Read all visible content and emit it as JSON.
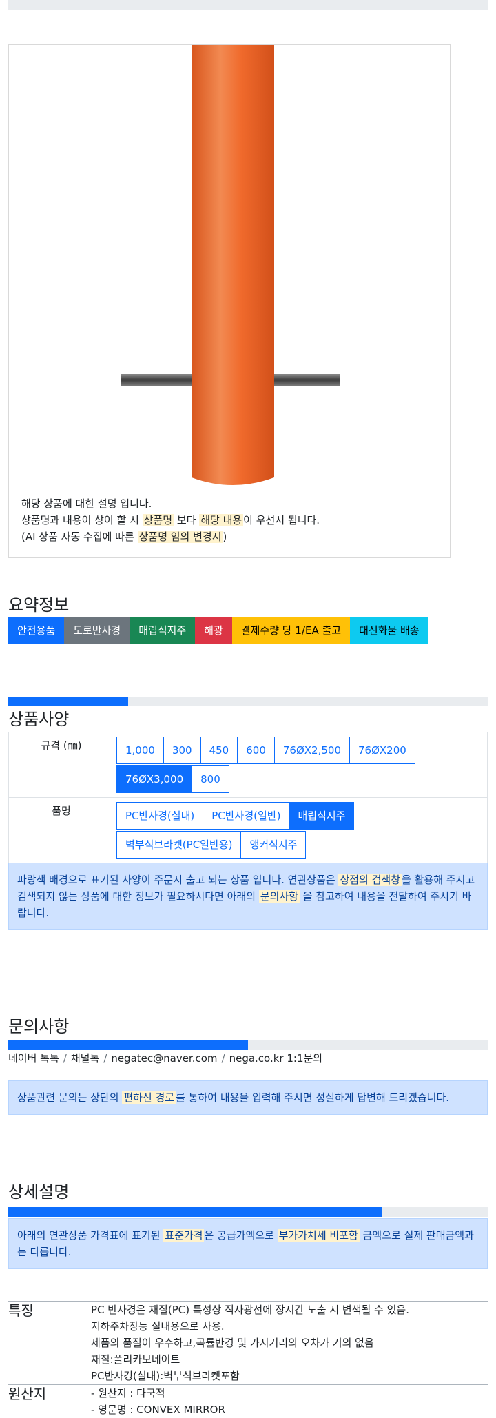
{
  "product_description": {
    "line1": "해당 상품에 대한 설명 입니다.",
    "line2_a": "상품명과 내용이 상이 할 시 ",
    "line2_hl1": "상품명",
    "line2_b": " 보다 ",
    "line2_hl2": "해당 내용",
    "line2_c": "이 우선시 됩니다.",
    "line3_a": "(AI 상품 자동 수집에 따른 ",
    "line3_hl": "상품명 임의 변경시",
    "line3_b": ")"
  },
  "summary": {
    "title": "요약정보",
    "badges": [
      {
        "label": "안전용품",
        "color": "#0d6efd"
      },
      {
        "label": "도로반사경",
        "color": "#6c757d"
      },
      {
        "label": "매립식지주",
        "color": "#198754"
      },
      {
        "label": "해광",
        "color": "#dc3545"
      },
      {
        "label": "결제수량 당 1/EA 출고",
        "color": "#ffc107"
      },
      {
        "label": "대신화물 배송",
        "color": "#0dcaf0"
      }
    ]
  },
  "spec": {
    "title": "상품사양",
    "progress": 0.25,
    "size_label": "규격 (㎜)",
    "size_options": [
      "1,000",
      "300",
      "450",
      "600",
      "76ØX2,500",
      "76ØX200",
      "76ØX3,000",
      "800"
    ],
    "size_selected": "76ØX3,000",
    "name_label": "품명",
    "name_options": [
      "PC반사경(실내)",
      "PC반사경(일반)",
      "매립식지주",
      "벽부식브라켓(PC일반용)",
      "앵커식지주"
    ],
    "name_selected": "매립식지주",
    "notice_a": "파랑색 배경으로 표기된 사양이 주문시 출고 되는 상품 입니다. 연관상품은 ",
    "notice_hl1": "상점의 검색창",
    "notice_b": "을 활용해 주시고 검색되지 않는 상품에 대한 정보가 필요하시다면 아래의 ",
    "notice_hl2": "문의사항",
    "notice_c": " 을 참고하여 내용을 전달하여 주시기 바랍니다."
  },
  "inquiry": {
    "title": "문의사항",
    "progress": 0.5,
    "contacts": [
      "네이버 톡톡",
      "채널톡",
      "negatec@naver.com",
      "nega.co.kr 1:1문의"
    ],
    "notice_a": "상품관련 문의는 상단의 ",
    "notice_hl": "편하신 경로",
    "notice_b": "를 통하여 내용을 입력해 주시면 성실하게 답변해 드리겠습니다."
  },
  "detail": {
    "title": "상세설명",
    "progress": 0.78,
    "notice_a": "아래의 연관상품 가격표에 표기된 ",
    "notice_hl1": "표준가격",
    "notice_b": "은 공급가액으로 ",
    "notice_hl2": "부가가치세 비포함",
    "notice_c": " 금액으로 실제 판매금액과는 다릅니다.",
    "features_label": "특징",
    "features": [
      "PC 반사경은 재질(PC) 특성상 직사광선에 장시간 노출 시 변색될 수 있음.",
      "지하주차장등 실내용으로 사용.",
      "제품의 품질이 우수하고,곡률반경 및 가시거리의 오차가 거의 없음",
      "재질:폴리카보네이트",
      "PC반사경(실내):벽부식브라켓포함"
    ],
    "origin_label": "원산지",
    "origin": [
      "- 원산지 : 다국적",
      "- 영문명 : CONVEX MIRROR"
    ]
  }
}
